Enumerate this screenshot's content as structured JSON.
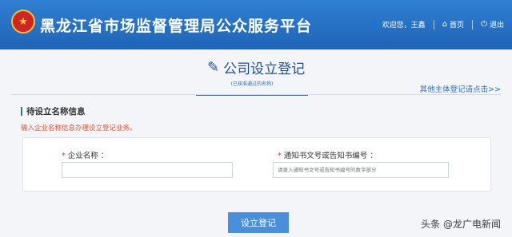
{
  "header": {
    "emblem_glyph": "★",
    "title": "黑龙江省市场监督管理局公众服务平台",
    "welcome": "欢迎您，王鑫",
    "home": "首页",
    "logout": "退出"
  },
  "page": {
    "title": "公司设立登记",
    "subtitle": "(已核准通过的名称)",
    "other_link": "其他主体登记请点击>>"
  },
  "section": {
    "title": "待设立名称信息",
    "hint": "输入企业名称信息办理设立登记业务。"
  },
  "form": {
    "company_name_label": "企业名称 ：",
    "company_name_value": "",
    "notice_label": "通知书文号或告知书编号 ：",
    "notice_placeholder": "请录入通知书文号或告知书编号的数字部分"
  },
  "actions": {
    "submit_label": "设立登记"
  },
  "watermark": "头条 @龙广电新闻",
  "colors": {
    "header_blue": "#1f64b6",
    "accent_blue": "#2c6fc2",
    "button_blue": "#4a8fdc",
    "hint_red": "#e2502d"
  }
}
